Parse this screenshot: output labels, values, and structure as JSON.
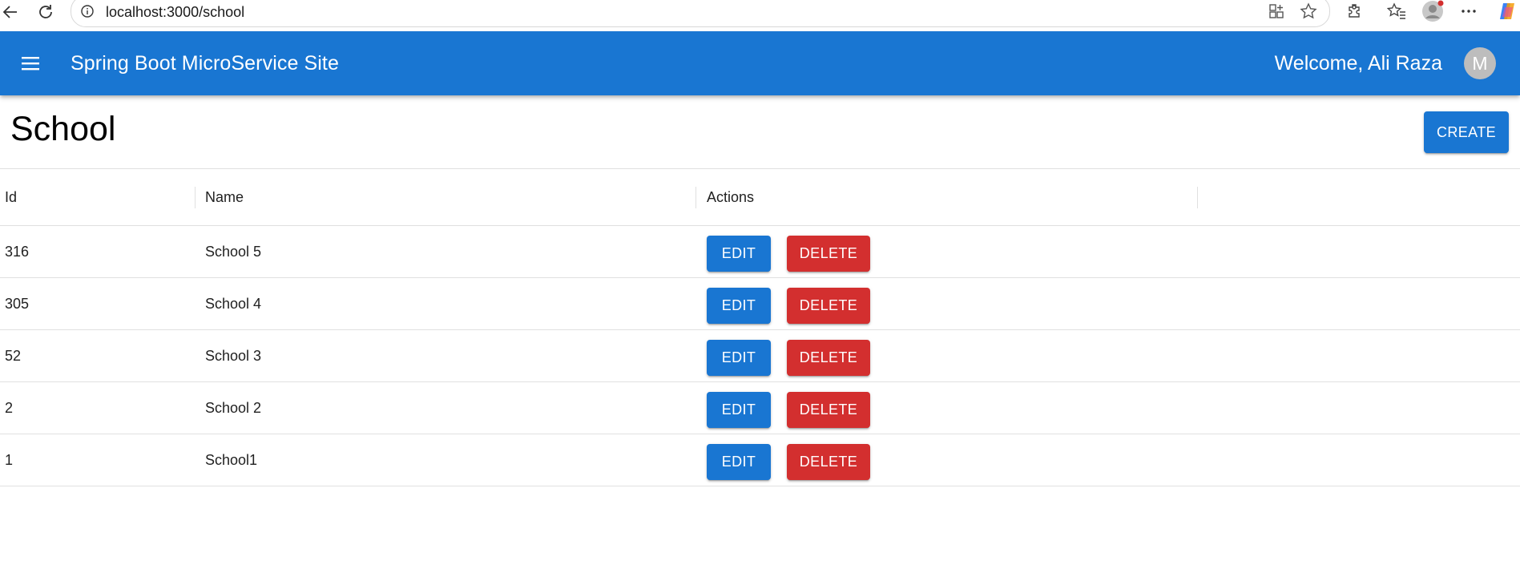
{
  "browser": {
    "url": "localhost:3000/school"
  },
  "appbar": {
    "title": "Spring Boot MicroService Site",
    "welcome": "Welcome, Ali Raza",
    "avatar_initial": "M",
    "color": "#1976d2"
  },
  "page": {
    "title": "School",
    "create_label": "CREATE"
  },
  "table": {
    "columns": [
      "Id",
      "Name",
      "Actions"
    ],
    "edit_label": "EDIT",
    "delete_label": "DELETE",
    "rows": [
      {
        "id": "316",
        "name": "School 5"
      },
      {
        "id": "305",
        "name": "School 4"
      },
      {
        "id": "52",
        "name": "School 3"
      },
      {
        "id": "2",
        "name": "School 2"
      },
      {
        "id": "1",
        "name": "School1"
      }
    ]
  },
  "colors": {
    "primary": "#1976d2",
    "danger": "#d32f2f"
  }
}
